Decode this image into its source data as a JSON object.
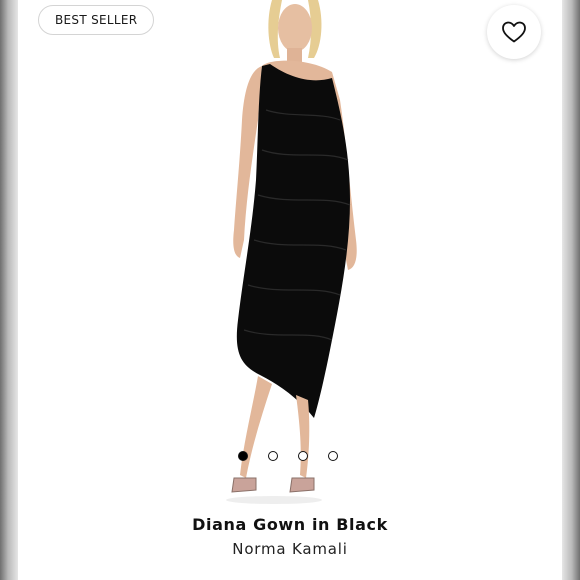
{
  "product": {
    "badge": "BEST SELLER",
    "name": "Diana Gown in Black",
    "brand": "Norma Kamali"
  },
  "gallery": {
    "image_count": 4,
    "active_index": 0
  },
  "icons": {
    "favorite": "heart-outline-icon"
  },
  "colors": {
    "dress": "#0b0b0b",
    "skin": "#e2b79a",
    "hair": "#e6cd93",
    "background": "#ffffff"
  }
}
